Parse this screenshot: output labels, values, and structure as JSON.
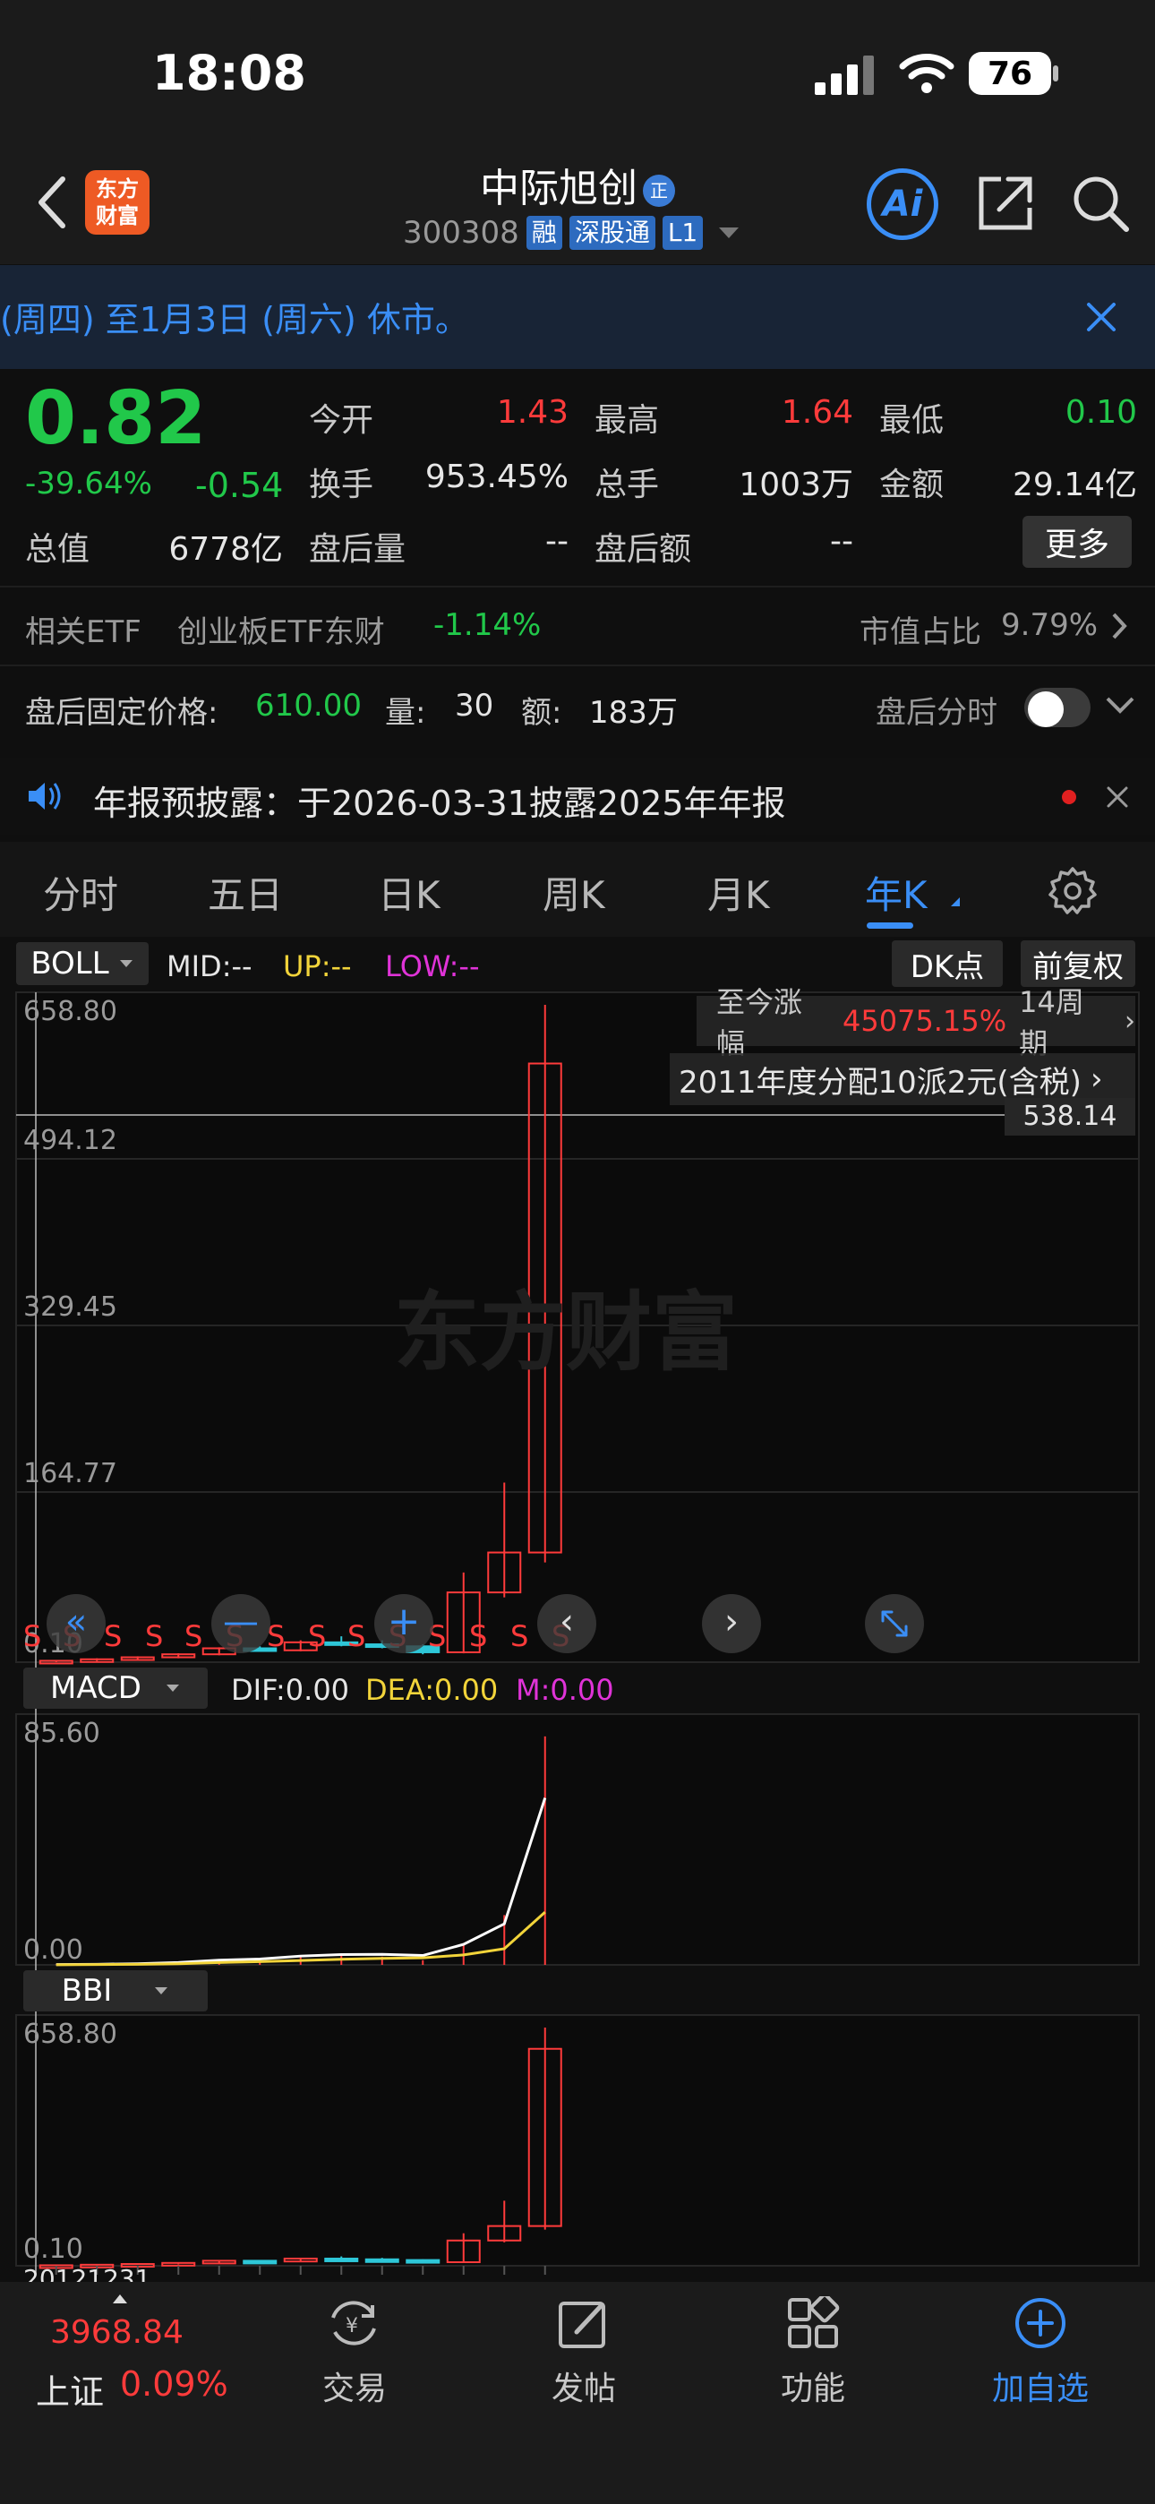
{
  "status": {
    "time": "18:08",
    "battery": "76"
  },
  "header": {
    "logo": [
      "东方",
      "财富"
    ],
    "stock_name": "中际旭创",
    "zheng_badge": "正",
    "code": "300308",
    "tags": [
      "融",
      "深股通",
      "L1"
    ],
    "ai_label": "Ai"
  },
  "notice": {
    "text": "(周四) 至1月3日 (周六) 休市。"
  },
  "quote": {
    "price": "0.82",
    "change_pct": "-39.64%",
    "change_abs": "-0.54",
    "fields": [
      {
        "label": "今开",
        "value": "1.43",
        "color": "#ff3b3b"
      },
      {
        "label": "最高",
        "value": "1.64",
        "color": "#ff3b3b"
      },
      {
        "label": "最低",
        "value": "0.10",
        "color": "#21c84a"
      },
      {
        "label": "换手",
        "value": "953.45%",
        "color": "#e6e6e6"
      },
      {
        "label": "总手",
        "value": "1003万",
        "color": "#e6e6e6"
      },
      {
        "label": "金额",
        "value": "29.14亿",
        "color": "#e6e6e6"
      },
      {
        "label": "总值",
        "value": "6778亿",
        "color": "#e6e6e6"
      },
      {
        "label": "盘后量",
        "value": "--",
        "color": "#e6e6e6"
      },
      {
        "label": "盘后额",
        "value": "--",
        "color": "#e6e6e6"
      }
    ],
    "more_label": "更多"
  },
  "etf": {
    "label": "相关ETF",
    "name": "创业板ETF东财",
    "change": "-1.14%",
    "ratio_label": "市值占比",
    "ratio": "9.79%"
  },
  "after_hours": {
    "price_label": "盘后固定价格:",
    "price": "610.00",
    "vol_label": "量:",
    "vol": "30",
    "amt_label": "额:",
    "amt": "183万",
    "minute_label": "盘后分时"
  },
  "announcement": {
    "text": "年报预披露：于2026-03-31披露2025年年报"
  },
  "tabs": [
    "分时",
    "五日",
    "日K",
    "周K",
    "月K",
    "年K"
  ],
  "active_tab": "年K",
  "main_chart": {
    "indicator": "BOLL",
    "mid": "MID:--",
    "up": "UP:--",
    "low": "LOW:--",
    "dk_label": "DK点",
    "fq_label": "前复权",
    "y_labels": [
      "658.80",
      "494.12",
      "329.45",
      "164.77",
      "0.10"
    ],
    "crosshair_value": "538.14",
    "gain_label": "至今涨幅",
    "gain_value": "45075.15%",
    "period": "14周期",
    "dividend": "2011年度分配10派2元(含税)",
    "watermark": "东方财富",
    "s_marks": [
      "S",
      "S",
      "S",
      "S",
      "S",
      "S",
      "S",
      "S",
      "S",
      "S",
      "S",
      "S",
      "S",
      "S"
    ]
  },
  "macd": {
    "indicator": "MACD",
    "dif": "DIF:0.00",
    "dea": "DEA:0.00",
    "m": "M:0.00",
    "y_labels": [
      "85.60",
      "0.00"
    ]
  },
  "bbi": {
    "indicator": "BBI",
    "y_labels": [
      "658.80",
      "0.10"
    ],
    "x_label": "20121231"
  },
  "chart_data": {
    "type": "candlestick",
    "period": "yearly",
    "ylim": [
      0.1,
      658.8
    ],
    "candles": [
      {
        "open": 0.1,
        "close": 1.5,
        "high": 2.0,
        "low": 0.1,
        "dir": "up"
      },
      {
        "open": 1.5,
        "close": 3.0,
        "high": 4.0,
        "low": 1.2,
        "dir": "up"
      },
      {
        "open": 3.0,
        "close": 5.0,
        "high": 6.0,
        "low": 2.5,
        "dir": "up"
      },
      {
        "open": 5.0,
        "close": 8.0,
        "high": 9.0,
        "low": 4.0,
        "dir": "up"
      },
      {
        "open": 8.0,
        "close": 14.0,
        "high": 15.0,
        "low": 7.0,
        "dir": "up"
      },
      {
        "open": 14.0,
        "close": 12.0,
        "high": 16.0,
        "low": 11.0,
        "dir": "down"
      },
      {
        "open": 12.0,
        "close": 20.0,
        "high": 22.0,
        "low": 11.0,
        "dir": "up"
      },
      {
        "open": 20.0,
        "close": 18.0,
        "high": 26.0,
        "low": 16.0,
        "dir": "down"
      },
      {
        "open": 18.0,
        "close": 16.0,
        "high": 22.0,
        "low": 14.0,
        "dir": "down"
      },
      {
        "open": 16.0,
        "close": 10.0,
        "high": 18.0,
        "low": 8.0,
        "dir": "down"
      },
      {
        "open": 10.0,
        "close": 70.0,
        "high": 90.0,
        "low": 9.0,
        "dir": "up"
      },
      {
        "open": 70.0,
        "close": 110.0,
        "high": 180.0,
        "low": 65.0,
        "dir": "up"
      },
      {
        "open": 110.0,
        "close": 600.0,
        "high": 658.8,
        "low": 100.0,
        "dir": "up"
      }
    ],
    "macd_dif": [
      0.1,
      0.2,
      0.4,
      0.8,
      1.6,
      2.0,
      3.0,
      3.5,
      3.6,
      3.2,
      7.0,
      14.0,
      57.0
    ],
    "macd_dea": [
      0.05,
      0.1,
      0.2,
      0.4,
      0.8,
      1.1,
      1.5,
      1.9,
      2.2,
      2.4,
      3.4,
      5.5,
      18.0
    ]
  },
  "bottom_nav": {
    "index_value": "3968.84",
    "index_name": "上证",
    "index_change": "0.09%",
    "items": [
      "交易",
      "发帖",
      "功能",
      "加自选"
    ]
  },
  "colors": {
    "up": "#ff3b3b",
    "down": "#2ec7d8",
    "accent": "#3a8ef6"
  }
}
